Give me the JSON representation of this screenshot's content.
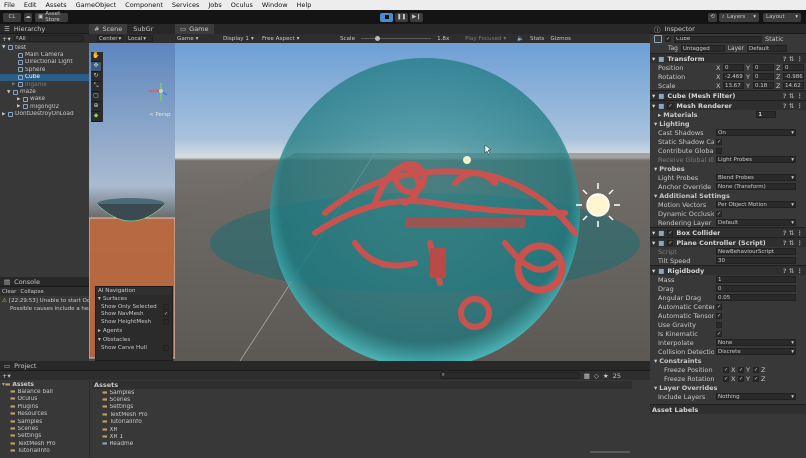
{
  "menu": [
    "File",
    "Edit",
    "Assets",
    "GameObject",
    "Component",
    "Services",
    "Jobs",
    "Oculus",
    "Window",
    "Help"
  ],
  "toolbar": {
    "account": "CL",
    "asset_store": "Asset Store",
    "layers": "Layers",
    "layout": "Layout"
  },
  "hierarchy": {
    "title": "Hierarchy",
    "search": "All",
    "items": [
      {
        "label": "test",
        "depth": 0,
        "arrow": "▼",
        "sel": false
      },
      {
        "label": "Main Camera",
        "depth": 2,
        "arrow": "",
        "sel": false
      },
      {
        "label": "Directional Light",
        "depth": 2,
        "arrow": "",
        "sel": false
      },
      {
        "label": "Sphere",
        "depth": 2,
        "arrow": "",
        "sel": false
      },
      {
        "label": "Cube",
        "depth": 2,
        "arrow": "",
        "sel": true
      },
      {
        "label": "Ingame",
        "depth": 2,
        "arrow": "▶",
        "sel": false,
        "dim": true
      },
      {
        "label": "maze",
        "depth": 1,
        "arrow": "▼",
        "sel": false
      },
      {
        "label": "wake",
        "depth": 3,
        "arrow": "▶",
        "sel": false
      },
      {
        "label": "migong02",
        "depth": 3,
        "arrow": "▶",
        "sel": false
      },
      {
        "label": "DontDestroyOnLoad",
        "depth": 0,
        "arrow": "▶",
        "sel": false
      }
    ]
  },
  "console": {
    "title": "Console",
    "clear": "Clear",
    "collapse": "Collapse",
    "count_warn": "30",
    "line1": "[22:29:53] Unable to start Oculus XR Plugin.",
    "line2": "Possible causes include a headset not being connected"
  },
  "scene": {
    "tab": "Scene",
    "tab2": "SubGr",
    "center": "Center",
    "local": "Local",
    "persp": "< Persp",
    "ai_title": "AI Navigation",
    "surfaces": "Surfaces",
    "show_only_selected": "Show Only Selected",
    "show_navmesh": "Show NavMesh",
    "show_heightmesh": "Show HeightMesh",
    "agents": "Agents",
    "obstacles": "Obstacles",
    "show_carve_hull": "Show Carve Hull"
  },
  "game": {
    "tab": "Game",
    "mode": "Game",
    "display": "Display 1",
    "aspect": "Free Aspect",
    "scale_label": "Scale",
    "scale_value": "1.8x",
    "play_focused": "Play Focused",
    "stats": "Stats",
    "gizmos": "Gizmos"
  },
  "inspector": {
    "title": "Inspector",
    "object_name": "Cube",
    "static_label": "Static",
    "tag_label": "Tag",
    "tag_value": "Untagged",
    "layer_label": "Layer",
    "layer_value": "Default",
    "transform": "Transform",
    "position": "Position",
    "rotation": "Rotation",
    "scale": "Scale",
    "pos": [
      "0",
      "0",
      "0"
    ],
    "rot": [
      "-2.469",
      "0",
      "-0.986"
    ],
    "scl": [
      "13.67",
      "0.18",
      "14.62"
    ],
    "mesh_filter": "Cube (Mesh Filter)",
    "mesh_renderer": "Mesh Renderer",
    "materials": "Materials",
    "materials_count": "1",
    "lighting": "Lighting",
    "cast_shadows": "Cast Shadows",
    "cast_shadows_v": "On",
    "static_shadow": "Static Shadow Caster",
    "contrib_gi": "Contribute Global Illumination",
    "receive_gi": "Receive Global Illum",
    "receive_gi_v": "Light Probes",
    "probes": "Probes",
    "light_probes": "Light Probes",
    "light_probes_v": "Blend Probes",
    "anchor": "Anchor Override",
    "anchor_v": "None (Transform)",
    "additional": "Additional Settings",
    "motion": "Motion Vectors",
    "motion_v": "Per Object Motion",
    "dyn_occ": "Dynamic Occlusion",
    "render_layer": "Rendering Layer Mask",
    "render_layer_v": "Default",
    "box_collider": "Box Collider",
    "plane_ctrl": "Plane Controller (Script)",
    "script": "Script",
    "script_v": "NewBehaviourScript",
    "tilt": "Tilt Speed",
    "tilt_v": "30",
    "rigidbody": "Rigidbody",
    "mass": "Mass",
    "mass_v": "1",
    "drag": "Drag",
    "drag_v": "0",
    "ang_drag": "Angular Drag",
    "ang_drag_v": "0.05",
    "auto_com": "Automatic Center Of Mass",
    "auto_tensor": "Automatic Tensor",
    "use_gravity": "Use Gravity",
    "is_kinematic": "Is Kinematic",
    "interp": "Interpolate",
    "interp_v": "None",
    "collision": "Collision Detection",
    "collision_v": "Discrete",
    "constraints": "Constraints",
    "freeze_pos": "Freeze Position",
    "freeze_rot": "Freeze Rotation",
    "layer_overrides": "Layer Overrides",
    "include_layers": "Include Layers",
    "include_layers_v": "Nothing",
    "asset_labels": "Asset Labels"
  },
  "project": {
    "title": "Project",
    "left_items": [
      "Assets",
      "Balance ball",
      "Oculus",
      "Plugins",
      "Resources",
      "Samples",
      "Scenes",
      "Settings",
      "TextMesh Pro",
      "TutorialInfo"
    ],
    "assets_header": "Assets",
    "right_items": [
      "Samples",
      "Scenes",
      "Settings",
      "TextMesh Pro",
      "TutorialInfo",
      "XR",
      "XR 1",
      "Readme"
    ],
    "count": "25"
  }
}
